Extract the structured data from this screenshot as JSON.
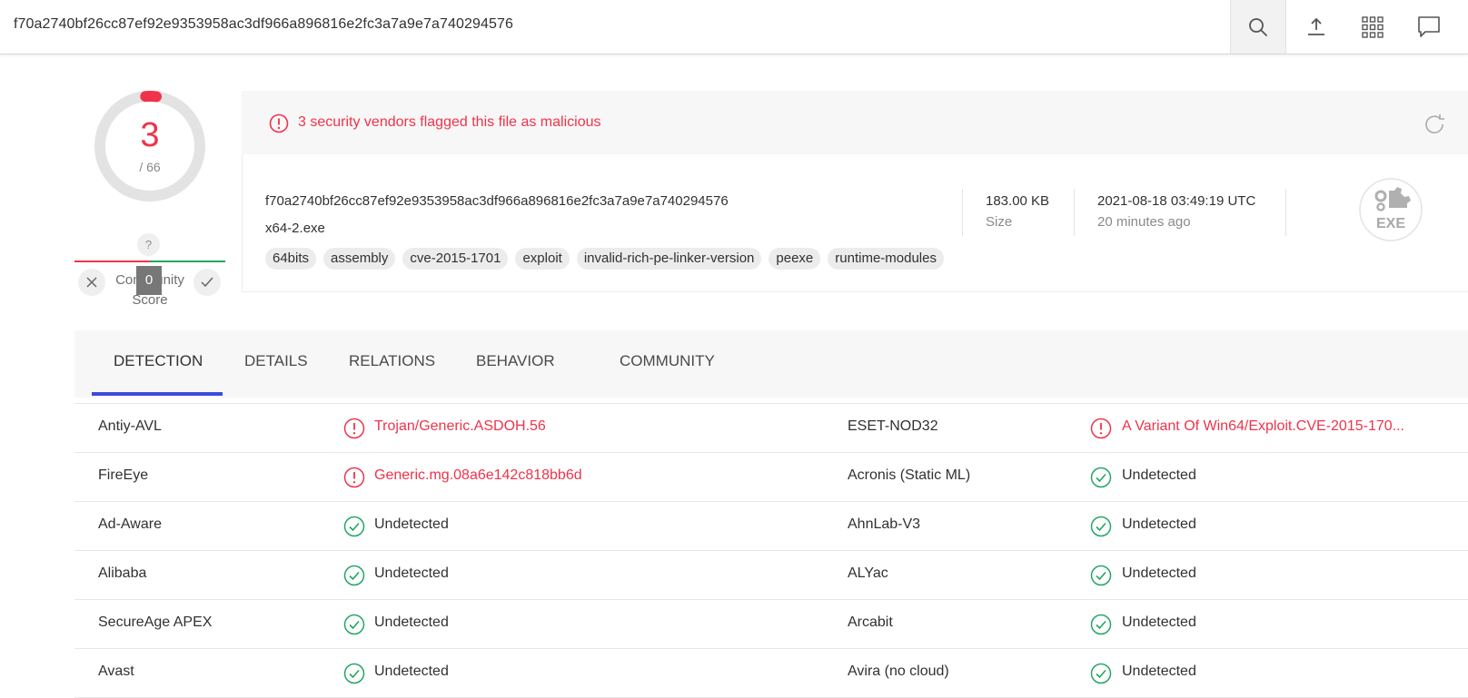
{
  "topbar": {
    "search_value": "f70a2740bf26cc87ef92e9353958ac3df966a896816e2fc3a7a9e7a740294576",
    "icons": [
      "search-icon",
      "upload-icon",
      "apps-grid-icon",
      "chat-icon"
    ]
  },
  "score": {
    "detections": "3",
    "total": "/ 66",
    "detection_ratio": 0.045
  },
  "community": {
    "help": "?",
    "value": "0",
    "label": "Community Score"
  },
  "summary": {
    "alert": "3 security vendors flagged this file as malicious",
    "hash": "f70a2740bf26cc87ef92e9353958ac3df966a896816e2fc3a7a9e7a740294576",
    "filename": "x64-2.exe",
    "tags": [
      "64bits",
      "assembly",
      "cve-2015-1701",
      "exploit",
      "invalid-rich-pe-linker-version",
      "peexe",
      "runtime-modules"
    ],
    "size_value": "183.00 KB",
    "size_label": "Size",
    "date_value": "2021-08-18 03:49:19 UTC",
    "date_ago": "20 minutes ago",
    "file_type": "EXE"
  },
  "tabs": [
    {
      "label": "DETECTION",
      "active": true
    },
    {
      "label": "DETAILS",
      "active": false
    },
    {
      "label": "RELATIONS",
      "active": false
    },
    {
      "label": "BEHAVIOR",
      "active": false
    },
    {
      "label": "COMMUNITY",
      "active": false
    }
  ],
  "detections": [
    {
      "left": {
        "vendor": "Antiy-AVL",
        "status": "malicious",
        "result": "Trojan/Generic.ASDOH.56"
      },
      "right": {
        "vendor": "ESET-NOD32",
        "status": "malicious",
        "result": "A Variant Of Win64/Exploit.CVE-2015-170..."
      }
    },
    {
      "left": {
        "vendor": "FireEye",
        "status": "malicious",
        "result": "Generic.mg.08a6e142c818bb6d"
      },
      "right": {
        "vendor": "Acronis (Static ML)",
        "status": "undetected",
        "result": "Undetected"
      }
    },
    {
      "left": {
        "vendor": "Ad-Aware",
        "status": "undetected",
        "result": "Undetected"
      },
      "right": {
        "vendor": "AhnLab-V3",
        "status": "undetected",
        "result": "Undetected"
      }
    },
    {
      "left": {
        "vendor": "Alibaba",
        "status": "undetected",
        "result": "Undetected"
      },
      "right": {
        "vendor": "ALYac",
        "status": "undetected",
        "result": "Undetected"
      }
    },
    {
      "left": {
        "vendor": "SecureAge APEX",
        "status": "undetected",
        "result": "Undetected"
      },
      "right": {
        "vendor": "Arcabit",
        "status": "undetected",
        "result": "Undetected"
      }
    },
    {
      "left": {
        "vendor": "Avast",
        "status": "undetected",
        "result": "Undetected"
      },
      "right": {
        "vendor": "Avira (no cloud)",
        "status": "undetected",
        "result": "Undetected"
      }
    }
  ],
  "colors": {
    "malicious": "#f0334b",
    "clean": "#22a565",
    "tab_accent": "#3c4bdf"
  }
}
